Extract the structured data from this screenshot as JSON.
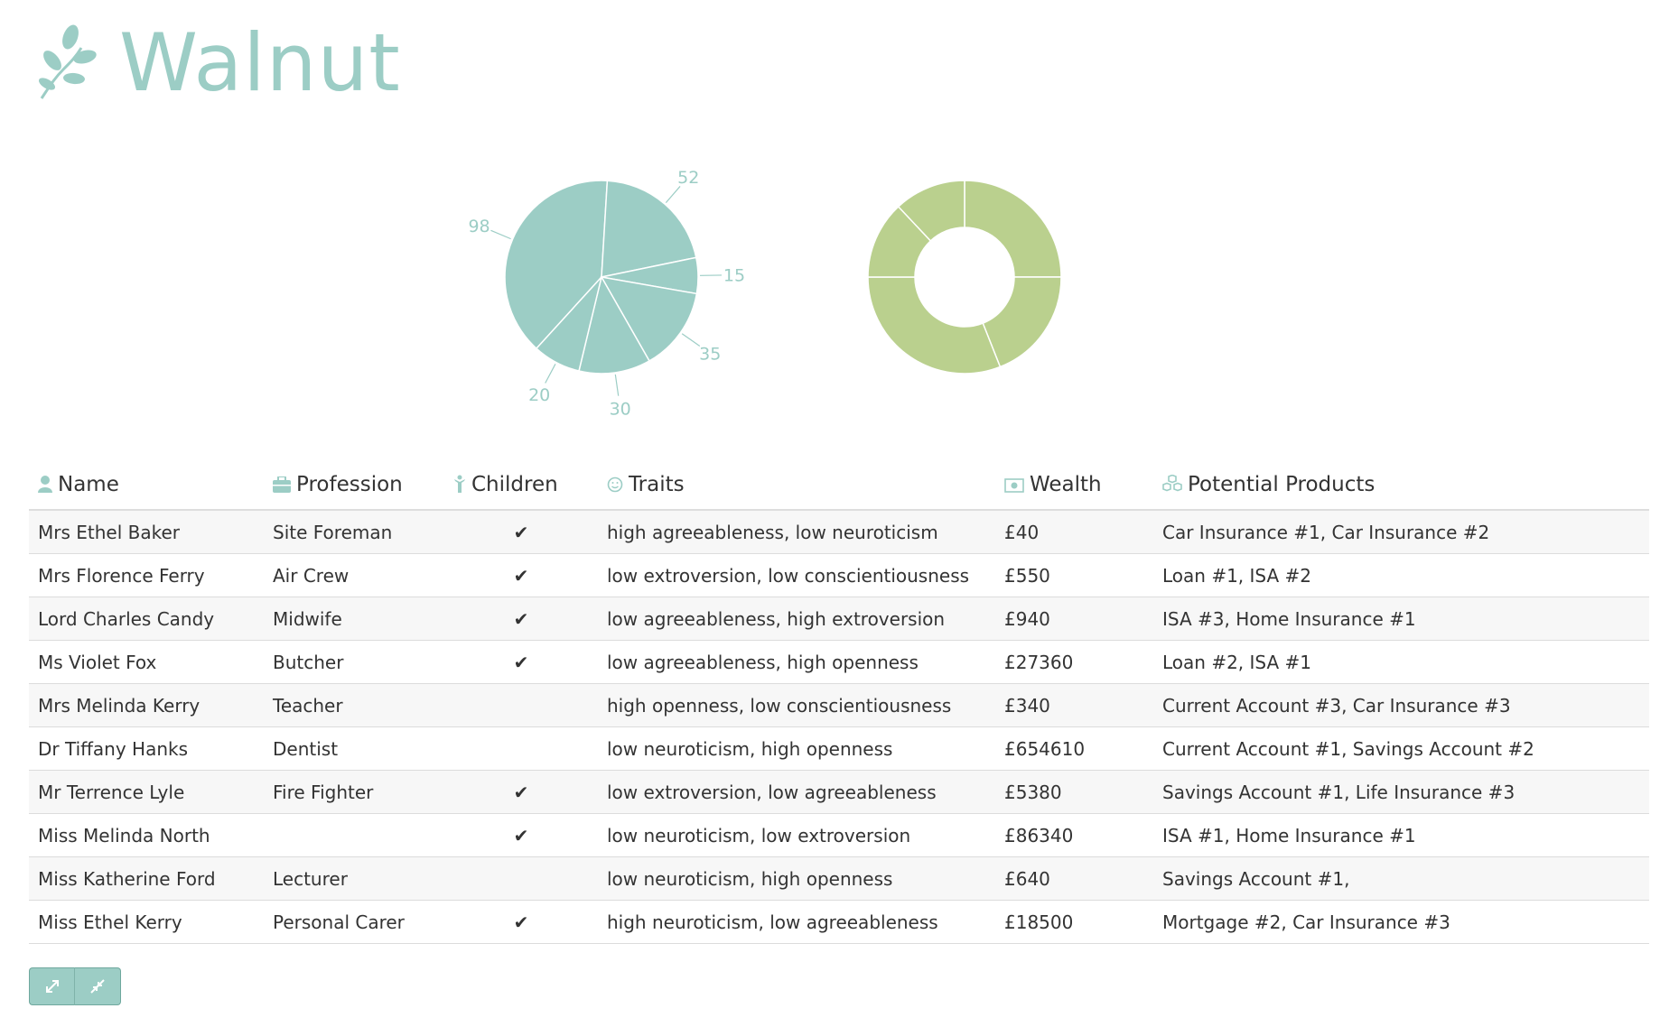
{
  "app": {
    "name": "Walnut",
    "brand_color": "#9ccdc5",
    "accent_color": "#bad08e"
  },
  "chart_data": [
    {
      "type": "pie",
      "values": [
        98,
        52,
        15,
        35,
        30,
        20
      ],
      "labels": [
        "98",
        "52",
        "15",
        "35",
        "30",
        "20"
      ],
      "color": "#9ccdc5"
    },
    {
      "type": "pie",
      "donut": true,
      "values": [
        25,
        19,
        31,
        13,
        12
      ],
      "color": "#bad08e"
    }
  ],
  "table": {
    "headers": {
      "name": "Name",
      "profession": "Profession",
      "children": "Children",
      "traits": "Traits",
      "wealth": "Wealth",
      "products": "Potential Products"
    },
    "header_icons": {
      "name": "user-icon",
      "profession": "briefcase-icon",
      "children": "child-icon",
      "traits": "smiley-icon",
      "wealth": "money-icon",
      "products": "cubes-icon"
    },
    "rows": [
      {
        "name": "Mrs Ethel Baker",
        "profession": "Site Foreman",
        "children": "✔",
        "traits": "high agreeableness, low neuroticism",
        "wealth": "£40",
        "products": "Car Insurance #1, Car Insurance #2"
      },
      {
        "name": "Mrs Florence Ferry",
        "profession": "Air Crew",
        "children": "✔",
        "traits": "low extroversion, low conscientiousness",
        "wealth": "£550",
        "products": "Loan #1, ISA #2"
      },
      {
        "name": "Lord Charles Candy",
        "profession": "Midwife",
        "children": "✔",
        "traits": "low agreeableness, high extroversion",
        "wealth": "£940",
        "products": "ISA #3, Home Insurance #1"
      },
      {
        "name": "Ms Violet Fox",
        "profession": "Butcher",
        "children": "✔",
        "traits": "low agreeableness, high openness",
        "wealth": "£27360",
        "products": "Loan #2, ISA #1"
      },
      {
        "name": "Mrs Melinda Kerry",
        "profession": "Teacher",
        "children": "",
        "traits": "high openness, low conscientiousness",
        "wealth": "£340",
        "products": "Current Account #3, Car Insurance #3"
      },
      {
        "name": "Dr Tiffany Hanks",
        "profession": "Dentist",
        "children": "",
        "traits": "low neuroticism, high openness",
        "wealth": "£654610",
        "products": "Current Account #1, Savings Account #2"
      },
      {
        "name": "Mr Terrence Lyle",
        "profession": "Fire Fighter",
        "children": "✔",
        "traits": "low extroversion, low agreeableness",
        "wealth": "£5380",
        "products": "Savings Account #1, Life Insurance #3"
      },
      {
        "name": "Miss Melinda North",
        "profession": "",
        "children": "✔",
        "traits": "low neuroticism, low extroversion",
        "wealth": "£86340",
        "products": "ISA #1, Home Insurance #1"
      },
      {
        "name": "Miss Katherine Ford",
        "profession": "Lecturer",
        "children": "",
        "traits": "low neuroticism, high openness",
        "wealth": "£640",
        "products": "Savings Account #1,"
      },
      {
        "name": "Miss Ethel Kerry",
        "profession": "Personal Carer",
        "children": "✔",
        "traits": "high neuroticism, low agreeableness",
        "wealth": "£18500",
        "products": "Mortgage #2, Car Insurance #3"
      }
    ]
  },
  "toolbar": {
    "expand_icon": "expand-icon",
    "compress_icon": "compress-icon"
  }
}
